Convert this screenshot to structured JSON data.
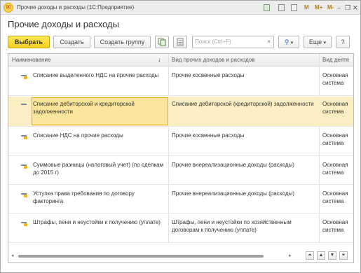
{
  "window": {
    "logo_text": "1С",
    "title": "Прочие доходы и расходы  (1С:Предприятие)",
    "title_icons": [
      "grid-icon",
      "calculator-icon",
      "calendar-icon"
    ],
    "memory_buttons": [
      "M",
      "M+",
      "M-"
    ],
    "controls": {
      "minimize": "–",
      "restore": "❐",
      "close": "✕"
    }
  },
  "page": {
    "title": "Прочие доходы и расходы"
  },
  "toolbar": {
    "choose_label": "Выбрать",
    "create_label": "Создать",
    "create_group_label": "Создать группу",
    "search_placeholder": "Поиск (Ctrl+F)",
    "search_clear": "×",
    "find_icon": "⚲",
    "find_arrow": "▾",
    "more_label": "Еще",
    "more_arrow": "▾",
    "help_label": "?"
  },
  "table": {
    "columns": [
      {
        "label": "Наименование"
      },
      {
        "label": "Вид прочих доходов и расходов"
      },
      {
        "label": "Вид деяте"
      }
    ],
    "sort_indicator": "↓",
    "rows": [
      {
        "name": "Списание выделенного НДС на прочие расходы",
        "kind": "Прочие косвенные расходы",
        "activity": "Основная система",
        "selected": false
      },
      {
        "name": "Списание дебиторской и кредиторской задолженности",
        "kind": "Списание дебиторской (кредиторской) задолженности",
        "activity": "Основная система",
        "selected": true
      },
      {
        "name": "Списание НДС на прочие расходы",
        "kind": "Прочие косвенные расходы",
        "activity": "Основная система",
        "selected": false
      },
      {
        "name": "Суммовые разницы (налоговый учет) (по сделкам до 2015 г)",
        "kind": "Прочие внереализационные доходы (расходы)",
        "activity": "Основная система",
        "selected": false
      },
      {
        "name": "Уступка права требования по договору факторинга",
        "kind": "Прочие внереализационные доходы (расходы)",
        "activity": "Основная система",
        "selected": false
      },
      {
        "name": "Штрафы, пени и неустойки к получению (уплате)",
        "kind": "Штрафы, пени и неустойки по хозяйственным договорам к получению (уплате)",
        "activity": "Основная система",
        "selected": false
      }
    ]
  },
  "scroll": {
    "left": "◂",
    "right": "▸"
  },
  "nav_buttons": {
    "first": "⏶",
    "up": "▲",
    "down": "▼",
    "last": "⏷"
  }
}
